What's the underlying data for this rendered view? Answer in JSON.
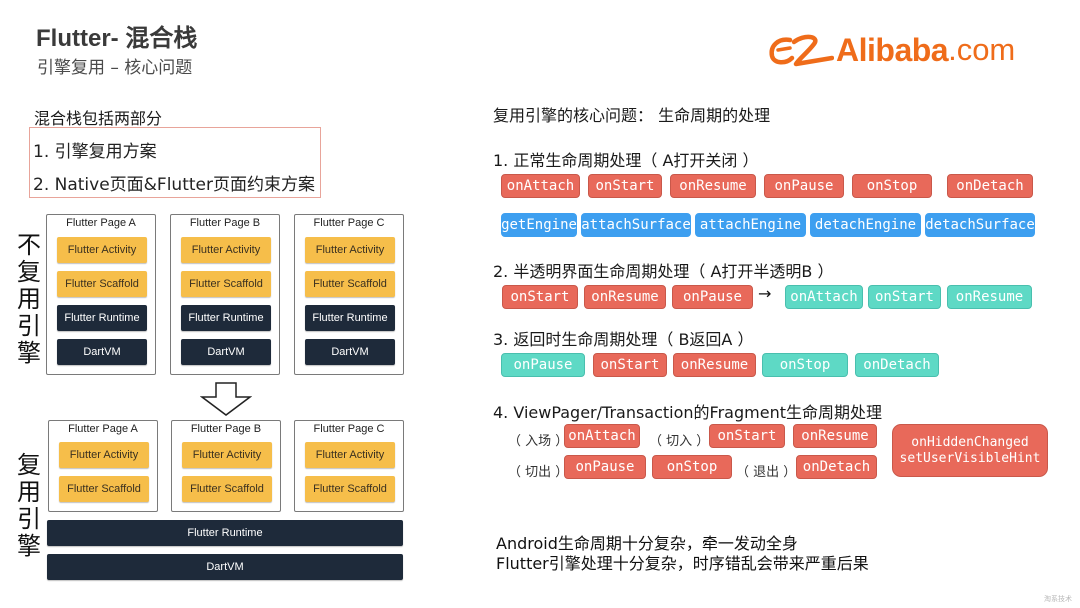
{
  "header": {
    "title": "Flutter- 混合栈",
    "subtitle": "引擎复用 – 核心问题"
  },
  "logo": {
    "brand": "Alibaba",
    "tld": ".com",
    "color": "#ef6c1a"
  },
  "left": {
    "heading": "混合栈包括两部分",
    "plans": [
      "1.  引擎复用方案",
      "2.  Native页面&Flutter页面约束方案"
    ],
    "no_reuse": {
      "label": [
        "不",
        "复",
        "用",
        "引",
        "擎"
      ],
      "pages": [
        {
          "title": "Flutter Page A",
          "layers": [
            "Flutter Activity",
            "Flutter Scaffold",
            "Flutter Runtime",
            "DartVM"
          ]
        },
        {
          "title": "Flutter Page B",
          "layers": [
            "Flutter Activity",
            "Flutter Scaffold",
            "Flutter Runtime",
            "DartVM"
          ]
        },
        {
          "title": "Flutter Page C",
          "layers": [
            "Flutter Activity",
            "Flutter Scaffold",
            "Flutter Runtime",
            "DartVM"
          ]
        }
      ]
    },
    "reuse": {
      "label": [
        "复",
        "用",
        "引",
        "擎"
      ],
      "pages": [
        {
          "title": "Flutter Page A",
          "layers": [
            "Flutter Activity",
            "Flutter Scaffold"
          ]
        },
        {
          "title": "Flutter Page B",
          "layers": [
            "Flutter Activity",
            "Flutter Scaffold"
          ]
        },
        {
          "title": "Flutter Page C",
          "layers": [
            "Flutter Activity",
            "Flutter Scaffold"
          ]
        }
      ],
      "shared": [
        "Flutter Runtime",
        "DartVM"
      ]
    }
  },
  "right": {
    "heading": "复用引擎的核心问题： 生命周期的处理",
    "s1": {
      "title": "1. 正常生命周期处理（ A打开关闭 ）",
      "row1": [
        "onAttach",
        "onStart",
        "onResume",
        "onPause",
        "onStop",
        "onDetach"
      ],
      "row2": [
        "getEngine",
        "attachSurface",
        "attachEngine",
        "detachEngine",
        "detachSurface"
      ]
    },
    "s2": {
      "title": "2. 半透明界面生命周期处理（ A打开半透明B ）",
      "before": [
        "onStart",
        "onResume",
        "onPause"
      ],
      "arrow": "→",
      "after": [
        "onAttach",
        "onStart",
        "onResume"
      ]
    },
    "s3": {
      "title": "3. 返回时生命周期处理（ B返回A ）",
      "chips": [
        "onPause",
        "onStart",
        "onResume",
        "onStop",
        "onDetach"
      ]
    },
    "s4": {
      "title": "4. ViewPager/Transaction的Fragment生命周期处理",
      "enter_label": "（ 入场 ）",
      "enter": "onAttach",
      "cut_in_label": "（ 切入 ）",
      "cut_in": [
        "onStart",
        "onResume"
      ],
      "cut_out_label": "（ 切出 ）",
      "cut_out": [
        "onPause",
        "onStop"
      ],
      "exit_label": "（ 退出 ）",
      "exit": "onDetach",
      "extra": [
        "onHiddenChanged",
        "setUserVisibleHint"
      ]
    },
    "summary": [
      "Android生命周期十分复杂，牵一发动全身",
      "Flutter引擎处理十分复杂，时序错乱会带来严重后果"
    ]
  },
  "watermark": "淘系技术",
  "colors": {
    "red": "#e8695a",
    "blue": "#3d9ff0",
    "teal": "#5ed9c5",
    "yellow": "#f6be4a",
    "dark": "#1e2a3a"
  }
}
